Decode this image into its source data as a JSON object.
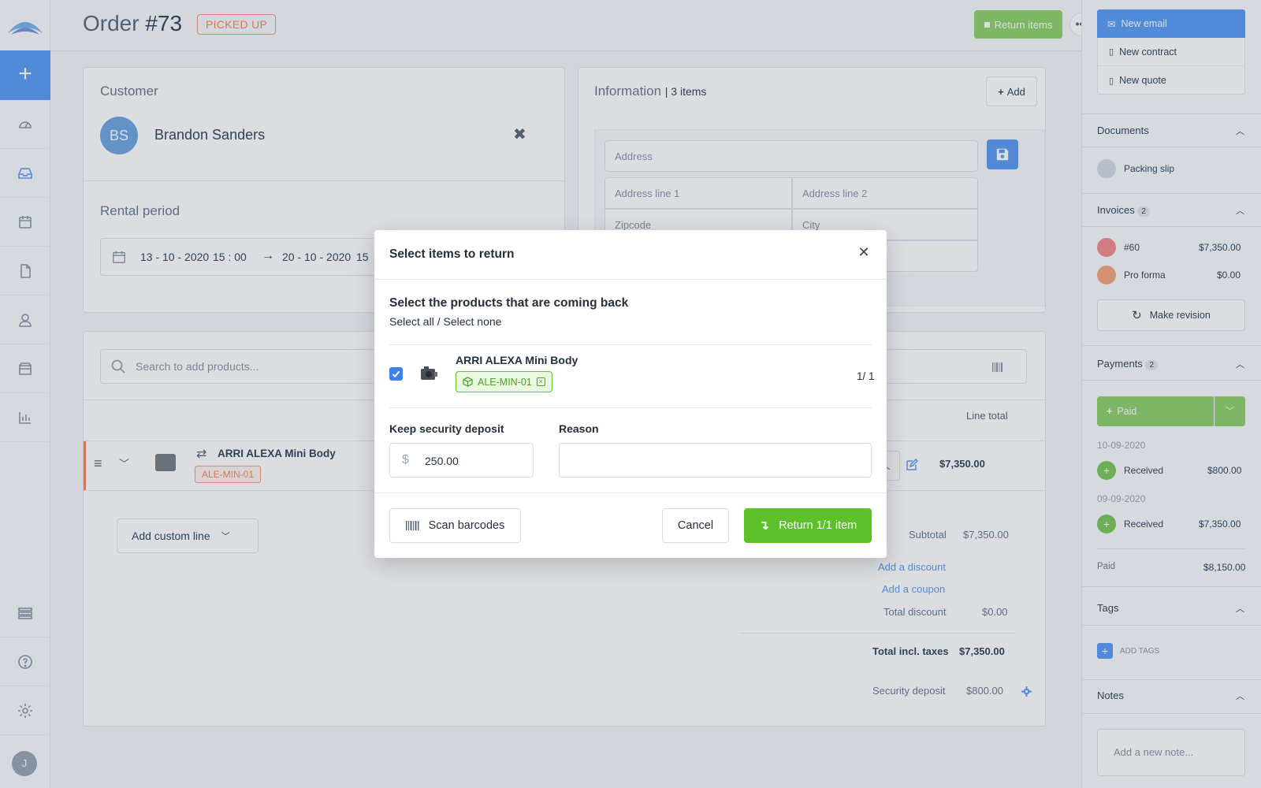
{
  "header": {
    "order_prefix": "Order ",
    "order_number": "#73",
    "status": "PICKED UP",
    "return_label": "Return items",
    "more_label": "•••"
  },
  "customer": {
    "label": "Customer",
    "initials": "BS",
    "name": "Brandon Sanders",
    "rental_label": "Rental period",
    "start_date": "13 - 10 - 2020",
    "start_time": "15 : 00",
    "end_date": "20 - 10 - 2020",
    "end_time_partial": "15"
  },
  "information": {
    "label": "Information",
    "count": "| 3 items",
    "add_label": "Add",
    "address_placeholder": "Address",
    "line1_placeholder": "Address line 1",
    "line2_placeholder": "Address line 2",
    "zip_placeholder": "Zipcode",
    "city_placeholder": "City"
  },
  "products": {
    "search_placeholder": "Search to add products...",
    "col_line_total": "Line total",
    "row": {
      "name": "ARRI ALEXA Mini Body",
      "tag": "ALE-MIN-01",
      "line_total": "$7,350.00"
    },
    "add_custom_label": "Add custom line"
  },
  "totals": {
    "subtotal_label": "Subtotal",
    "subtotal": "$7,350.00",
    "add_discount": "Add a discount",
    "add_coupon": "Add a coupon",
    "total_discount_label": "Total discount",
    "total_discount": "$0.00",
    "total_label": "Total incl. taxes",
    "total": "$7,350.00",
    "deposit_label": "Security deposit",
    "deposit": "$800.00"
  },
  "sidebar": {
    "new_email": "New email",
    "new_contract": "New contract",
    "new_quote": "New quote",
    "documents_title": "Documents",
    "packing_slip": "Packing slip",
    "invoices_title": "Invoices",
    "invoices_count": "2",
    "invoices": [
      {
        "label": "#60",
        "amount": "$7,350.00"
      },
      {
        "label": "Pro forma",
        "amount": "$0.00"
      }
    ],
    "make_revision": "Make revision",
    "payments_title": "Payments",
    "payments_count": "2",
    "paid_btn": "Paid",
    "payments": [
      {
        "date": "10-09-2020",
        "label": "Received",
        "amount": "$800.00"
      },
      {
        "date": "09-09-2020",
        "label": "Received",
        "amount": "$7,350.00"
      }
    ],
    "paid_label": "Paid",
    "paid_total": "$8,150.00",
    "tags_title": "Tags",
    "add_tags": "ADD TAGS",
    "notes_title": "Notes",
    "note_placeholder": "Add a new note..."
  },
  "modal": {
    "title": "Select items to return",
    "subtitle": "Select the products that are coming back",
    "select_all": "Select all",
    "select_sep": " / ",
    "select_none": "Select none",
    "product_name": "ARRI ALEXA Mini Body",
    "product_tag": "ALE-MIN-01",
    "product_checked": true,
    "qty": "1/ 1",
    "deposit_label": "Keep security deposit",
    "currency": "$",
    "deposit_value": "250.00",
    "reason_label": "Reason",
    "reason_value": "",
    "scan_label": "Scan barcodes",
    "cancel_label": "Cancel",
    "return_label": "Return 1/1 item"
  },
  "colors": {
    "accent_blue": "#5b9df2",
    "green": "#5cc12b",
    "status_orange": "#f08a5d"
  }
}
